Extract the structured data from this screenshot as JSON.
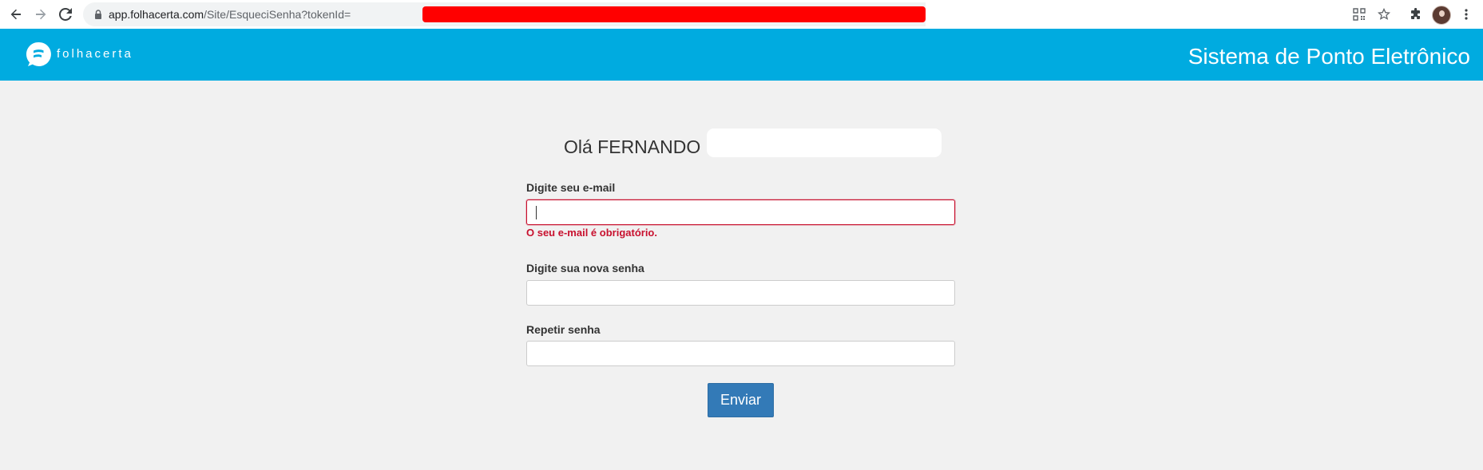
{
  "browser": {
    "url_host": "app.folhacerta.com",
    "url_path": "/Site/EsqueciSenha?tokenId=",
    "back_icon": "arrow-left-icon",
    "forward_icon": "arrow-right-icon",
    "reload_icon": "reload-icon",
    "lock_icon": "lock-icon"
  },
  "header": {
    "logo_text": "folhacerta",
    "title": "Sistema de Ponto Eletrônico",
    "background": "#00abe0"
  },
  "form": {
    "greeting": "Olá FERNANDO",
    "email_label": "Digite seu e-mail",
    "email_value": "",
    "email_error": "O seu e-mail é obrigatório.",
    "password_label": "Digite sua nova senha",
    "password_value": "",
    "repeat_label": "Repetir senha",
    "repeat_value": "",
    "submit_label": "Enviar",
    "submit_color": "#337ab7",
    "error_color": "#c8102e"
  }
}
